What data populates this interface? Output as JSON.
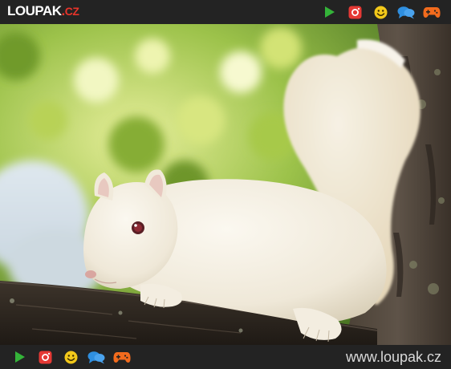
{
  "header": {
    "logo_main": "LOUPAK",
    "logo_dot": ".",
    "logo_tld": "CZ"
  },
  "icons": {
    "play": "play-icon",
    "instagram": "instagram-icon",
    "smiley": "smiley-icon",
    "chat": "chat-bubbles-icon",
    "gamepad": "gamepad-icon"
  },
  "footer": {
    "site_url": "www.loupak.cz"
  },
  "colors": {
    "bar_background": "#232323",
    "play": "#34b339",
    "instagram": "#e53935",
    "smiley": "#f2c81a",
    "chat": "#2f8fe0",
    "gamepad": "#f26b1d",
    "logo_accent": "#e8342a"
  }
}
